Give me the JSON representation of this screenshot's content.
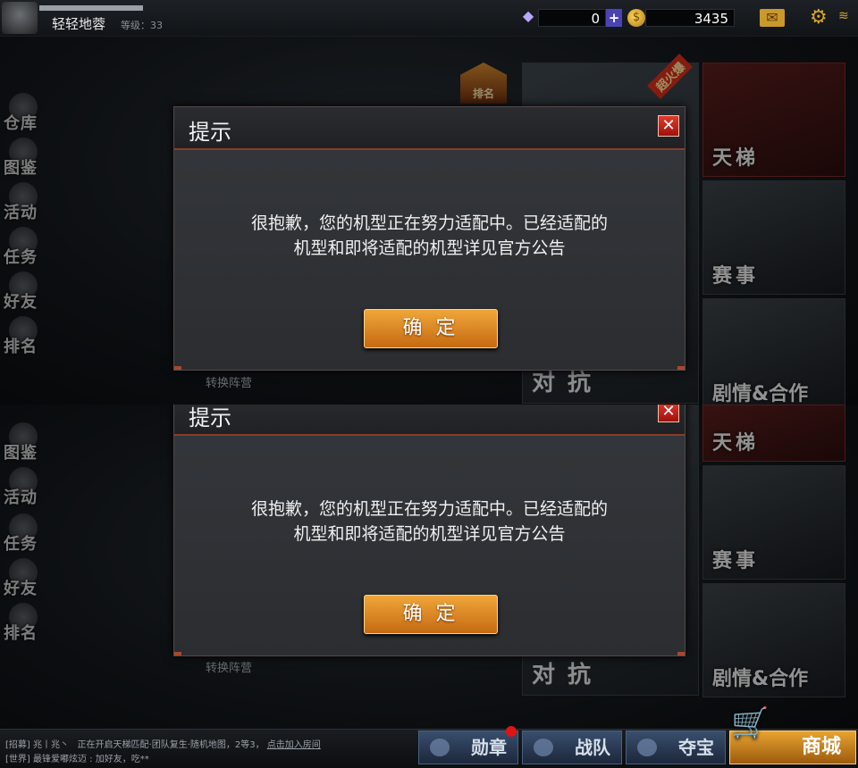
{
  "player": {
    "name": "轻轻地蓉",
    "level": "等级：33"
  },
  "currency": {
    "diamonds": "0",
    "plus": "+",
    "coins": "3435"
  },
  "icons": {
    "gem": "diamond-icon",
    "coin": "coin-icon",
    "mail": "mail-icon",
    "settings": "gear-icon",
    "signal": "wifi-icon"
  },
  "left_nav": [
    {
      "label": "仓库"
    },
    {
      "label": "图鉴"
    },
    {
      "label": "活动"
    },
    {
      "label": "任务"
    },
    {
      "label": "好友"
    },
    {
      "label": "排名"
    }
  ],
  "modes": {
    "ladder": "天梯",
    "event": "赛事",
    "story": "剧情&合作",
    "versus": "对抗",
    "ribbon": "超火爆",
    "rank_badge": "排名"
  },
  "switch_camp": "转换阵营",
  "dialog": {
    "title": "提示",
    "close": "✕",
    "message_line1": "很抱歉，您的机型正在努力适配中。已经适配的",
    "message_line2": "机型和即将适配的机型详见官方公告",
    "ok": "确 定"
  },
  "chat": {
    "line1_tag": "[招募] 兆丨兆丶",
    "line1_text": "正在开启天梯匹配·团队复生·随机地图，2等3，",
    "line1_link": "点击加入房间",
    "line2": "[世界] 最锋爱嘟炫迈 : 加好友，吃**"
  },
  "bottom_tabs": {
    "medal": "勋章",
    "team": "战队",
    "treasure": "夺宝",
    "shop": "商城"
  },
  "colors": {
    "accent": "#d9a22a",
    "ok_button": "#e08a22",
    "close": "#c81d12"
  }
}
